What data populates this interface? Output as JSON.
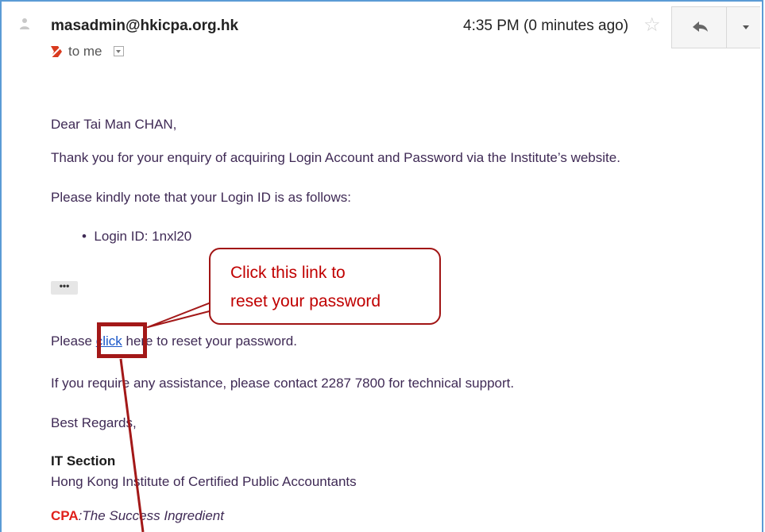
{
  "header": {
    "sender": "masadmin@hkicpa.org.hk",
    "time": "4:35 PM (0 minutes ago)",
    "recipient_label": "to me"
  },
  "icons": {
    "avatar": "person-icon",
    "star": "star-icon",
    "reply": "reply-icon",
    "more": "chevron-down-icon",
    "importance": "importance-marker-icon",
    "recipient_details": "dropdown-icon"
  },
  "body": {
    "greeting": "Dear Tai Man CHAN,",
    "intro": "Thank you for your enquiry of acquiring Login Account and Password via the Institute’s website.",
    "note": "Please kindly note that your Login ID is as follows:",
    "login_bullet": "Login ID: 1nxl20",
    "trimmed_content": "•••",
    "reset_before": "Please ",
    "reset_link": "click",
    "reset_after": " here to reset your password.",
    "support": "If you require any assistance, please contact 2287 7800 for technical support.",
    "closing": "Best Regards,"
  },
  "signature": {
    "section": "IT Section",
    "org": "Hong Kong Institute of Certified Public Accountants",
    "tag_bold": "CPA",
    "tag_rest": ":The Success Ingredient"
  },
  "annotation": {
    "callout_line1": "Click this link to",
    "callout_line2": "reset your password"
  },
  "colors": {
    "frame": "#5b9bd5",
    "annotation_red": "#a31818",
    "callout_text": "#c00000",
    "link": "#1a57c9",
    "cpa_red": "#e0201b"
  }
}
